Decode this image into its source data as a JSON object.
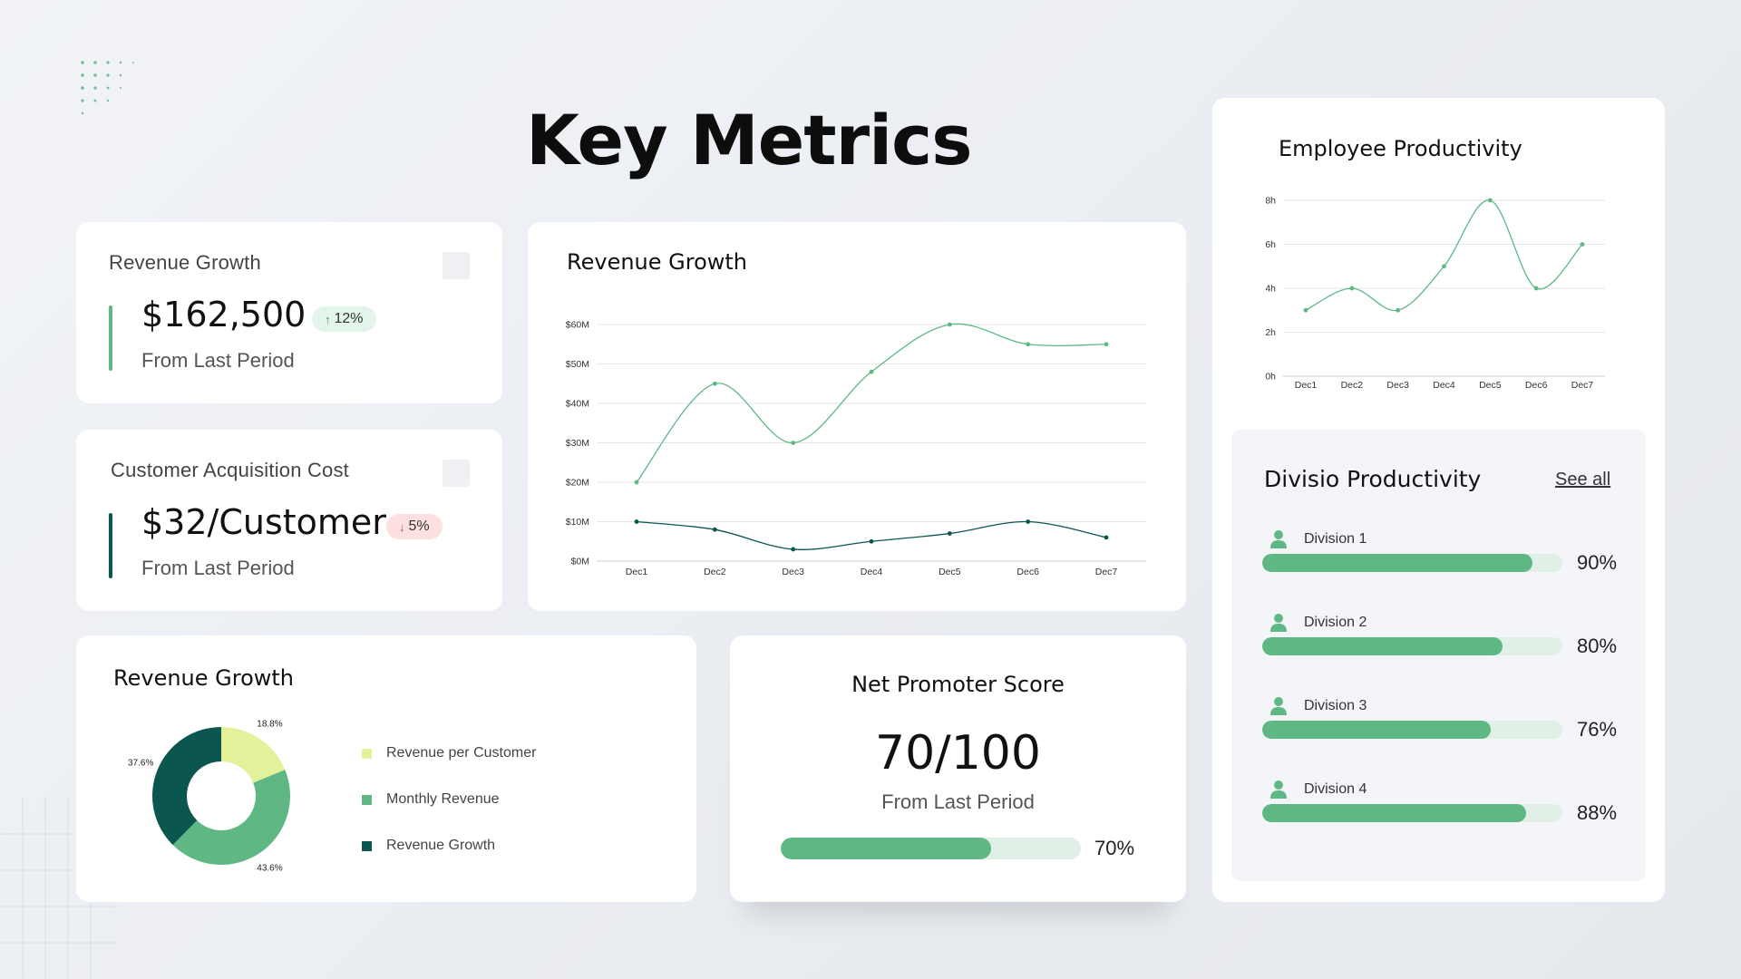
{
  "page": {
    "title": "Key Metrics"
  },
  "colors": {
    "green": "#5fb884",
    "dark_teal": "#0b5750",
    "light_yellow": "#e2f29b",
    "pill_green_bg": "#e3f4ea",
    "pill_red_bg": "#fde1e1"
  },
  "kpi_revenue": {
    "label": "Revenue Growth",
    "value": "$162,500",
    "badge": "12%",
    "badge_icon": "arrow-up-icon",
    "sub": "From Last Period"
  },
  "kpi_cac": {
    "label": "Customer Acquisition Cost",
    "value": "$32/Customer",
    "badge": "5%",
    "badge_icon": "arrow-down-icon",
    "sub": "From Last Period"
  },
  "revenue_line": {
    "title": "Revenue Growth"
  },
  "employee_line": {
    "title": "Employee Productivity"
  },
  "revenue_donut": {
    "title": "Revenue Growth"
  },
  "nps": {
    "title": "Net Promoter Score",
    "value": "70/100",
    "sub": "From Last Period",
    "progress": 0.7,
    "progress_label": "70%"
  },
  "division": {
    "title": "Divisio Productivity",
    "see_all": "See all",
    "items": [
      {
        "name": "Division 1",
        "value": 0.9,
        "label": "90%"
      },
      {
        "name": "Division 2",
        "value": 0.8,
        "label": "80%"
      },
      {
        "name": "Division 3",
        "value": 0.76,
        "label": "76%"
      },
      {
        "name": "Division 4",
        "value": 0.88,
        "label": "88%"
      }
    ]
  },
  "chart_data": [
    {
      "type": "line",
      "title": "Revenue Growth",
      "categories": [
        "Dec1",
        "Dec2",
        "Dec3",
        "Dec4",
        "Dec5",
        "Dec6",
        "Dec7"
      ],
      "series": [
        {
          "values": [
            20,
            45,
            30,
            48,
            60,
            55,
            55
          ],
          "color": "#5fb884"
        },
        {
          "values": [
            10,
            8,
            3,
            5,
            7,
            10,
            6
          ],
          "color": "#0b5750"
        }
      ],
      "yticks": [
        "$0M",
        "$10M",
        "$20M",
        "$30M",
        "$40M",
        "$50M",
        "$60M"
      ],
      "ylim": [
        0,
        60
      ],
      "grid": true
    },
    {
      "type": "line",
      "title": "Employee Productivity",
      "categories": [
        "Dec1",
        "Dec2",
        "Dec3",
        "Dec4",
        "Dec5",
        "Dec6",
        "Dec7"
      ],
      "series": [
        {
          "values": [
            3,
            4,
            3,
            5,
            8,
            4,
            6
          ],
          "color": "#5fb884"
        }
      ],
      "yticks": [
        "0h",
        "2h",
        "4h",
        "6h",
        "8h"
      ],
      "ylim": [
        0,
        8
      ],
      "grid": true
    },
    {
      "type": "pie",
      "title": "Revenue Growth",
      "labels": [
        "Revenue per Customer",
        "Monthly Revenue",
        "Revenue Growth"
      ],
      "values": [
        18.8,
        43.6,
        37.6
      ],
      "value_labels": [
        "18.8%",
        "43.6%",
        "37.6%"
      ],
      "colors": [
        "#e2f29b",
        "#5fb884",
        "#0b5750"
      ],
      "donut": true
    }
  ]
}
